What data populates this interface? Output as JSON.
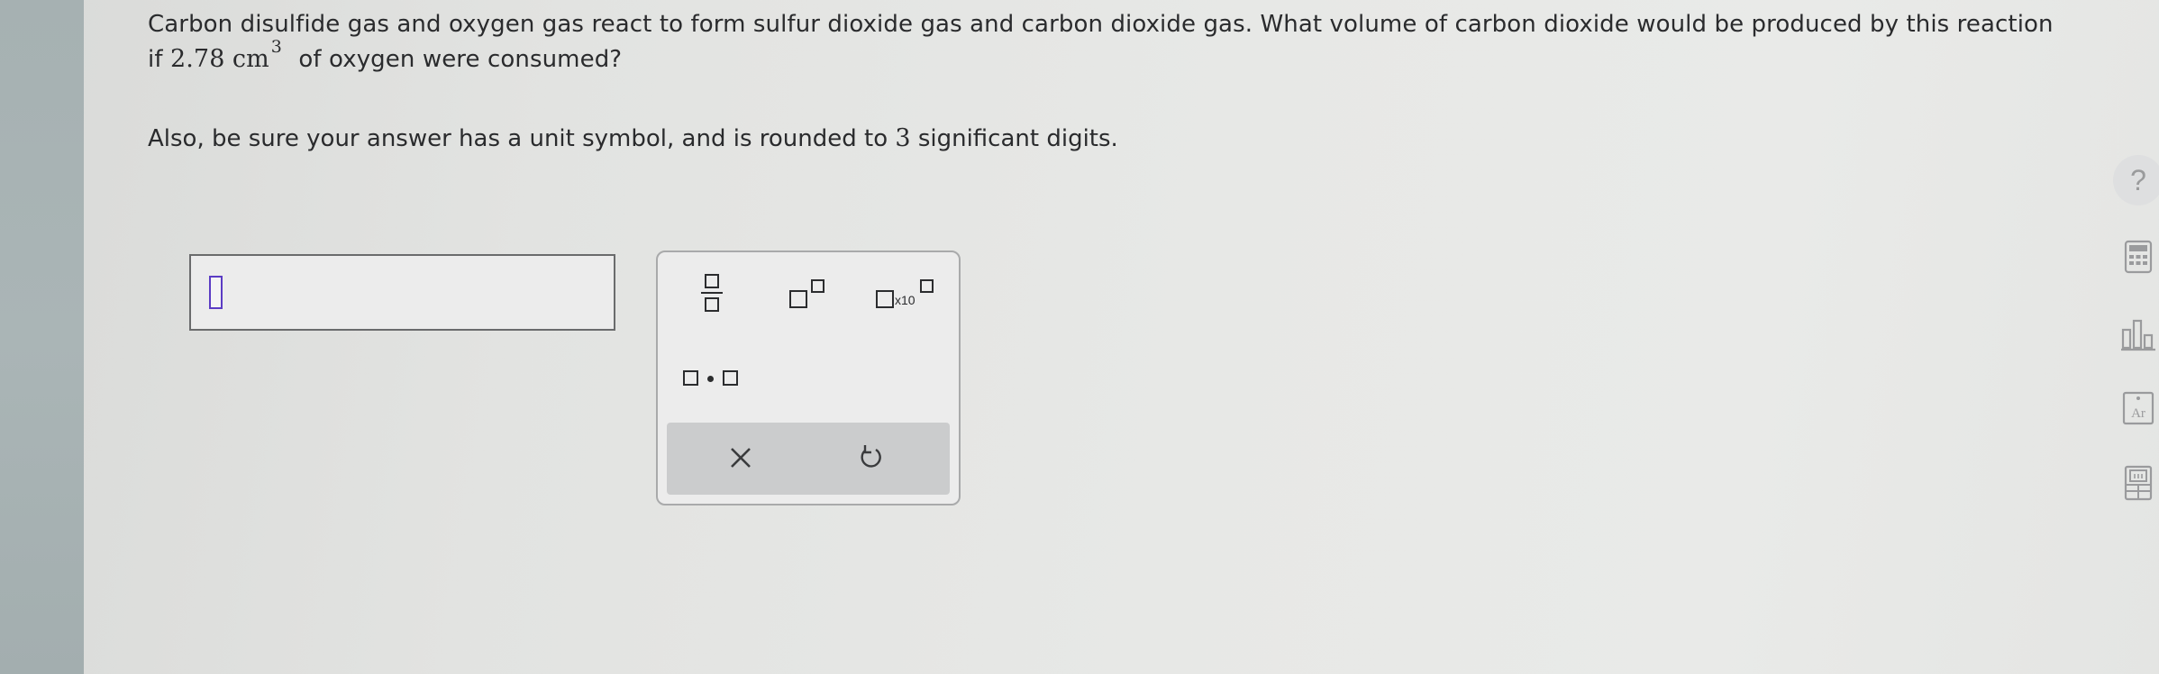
{
  "question": {
    "text_line1": "Carbon disulfide gas and oxygen gas react to form sulfur dioxide gas and carbon dioxide gas. What volume of carbon dioxide would be produced by this reaction",
    "line2_prefix": "if",
    "quantity": "2.78",
    "unit": "cm",
    "unit_exponent": "3",
    "line2_suffix": "of oxygen were consumed?",
    "instruction_prefix": "Also, be sure your answer has a unit symbol, and is rounded to",
    "sig_figs": "3",
    "instruction_suffix": "significant digits."
  },
  "answer": {
    "value": ""
  },
  "palette": {
    "buttons": [
      "fraction",
      "superscript",
      "scientific-notation",
      "multiplication-dot"
    ],
    "x10_label": "x10",
    "footer": [
      "clear",
      "undo"
    ]
  },
  "side_tools": {
    "help_label": "?",
    "items": [
      "help",
      "calculator",
      "data",
      "periodic-table",
      "reference"
    ],
    "periodic_label": "Ar"
  }
}
